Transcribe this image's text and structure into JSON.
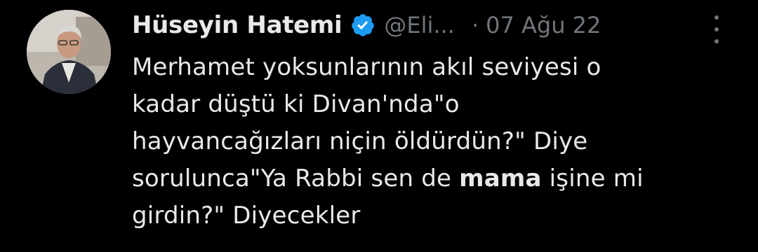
{
  "tweet": {
    "display_name": "Hüseyin Hatemi",
    "handle": "@Eli...",
    "separator": "·",
    "date": "07 Ağu 22",
    "verified_icon": "verified-badge-icon",
    "accent_color": "#1d9bf0",
    "text_lines": [
      {
        "pre": "Merhamet yoksunlarının akıl seviyesi o",
        "bold": "",
        "post": ""
      },
      {
        "pre": "kadar düştü ki Divan'nda\"o",
        "bold": "",
        "post": ""
      },
      {
        "pre": "hayvancağızları niçin öldürdün?\" Diye",
        "bold": "",
        "post": ""
      },
      {
        "pre": "sorulunca\"Ya Rabbi sen de ",
        "bold": "mama",
        "post": " işine mi"
      },
      {
        "pre": "girdin?\" Diyecekler",
        "bold": "",
        "post": ""
      }
    ]
  }
}
